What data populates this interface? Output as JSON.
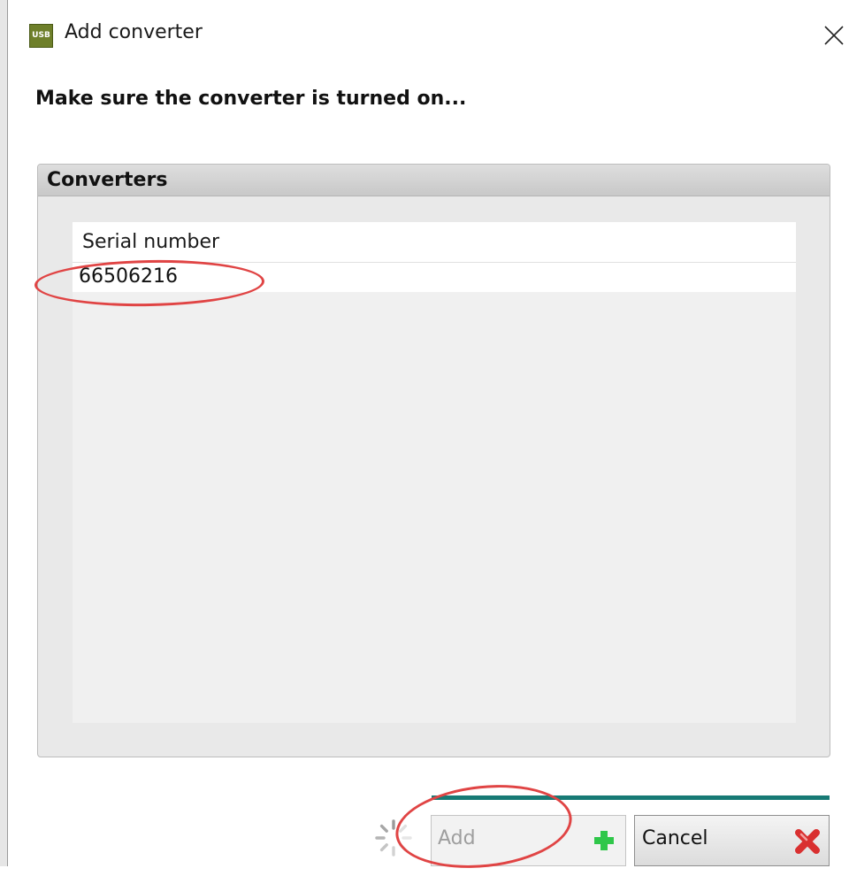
{
  "window": {
    "title": "Add converter",
    "app_icon": {
      "name": "usb-icon",
      "text": "USB"
    }
  },
  "heading": "Make sure the converter is turned on...",
  "converters": {
    "group_title": "Converters",
    "columns": [
      "Serial number"
    ],
    "rows": [
      {
        "serial_number": "66506216"
      }
    ]
  },
  "buttons": {
    "add_label": "Add",
    "add_enabled": false,
    "cancel_label": "Cancel"
  },
  "colors": {
    "annotation": "#e04444",
    "progress": "#177a75",
    "add_icon": "#2fc74a",
    "cancel_icon": "#d93030"
  },
  "icons": {
    "close": "close-icon",
    "add": "plus-icon",
    "cancel": "red-x-icon",
    "busy": "spinner-icon"
  }
}
